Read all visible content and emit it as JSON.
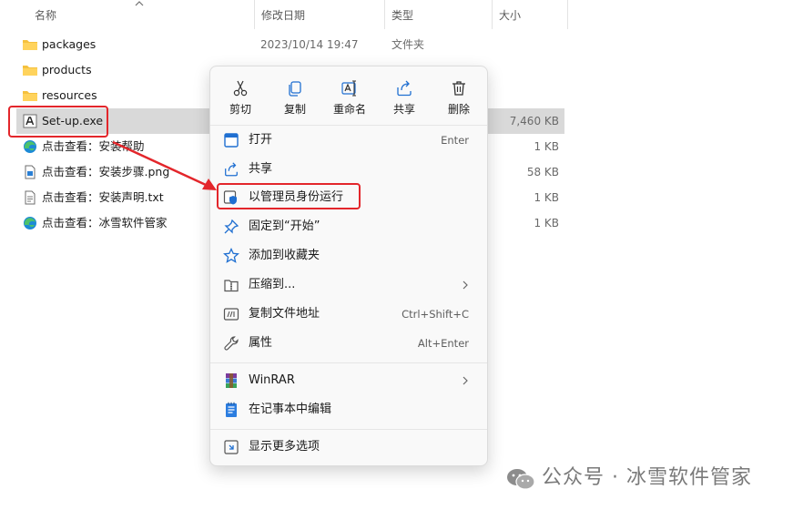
{
  "columns": {
    "name": "名称",
    "date": "修改日期",
    "type": "类型",
    "size": "大小"
  },
  "files": [
    {
      "name": "packages",
      "date": "2023/10/14 19:47",
      "type": "文件夹",
      "size": "",
      "icon": "folder-icon"
    },
    {
      "name": "products",
      "date": "",
      "type": "",
      "size": "",
      "icon": "folder-icon"
    },
    {
      "name": "resources",
      "date": "",
      "type": "",
      "size": "",
      "icon": "folder-icon"
    },
    {
      "name": "Set-up.exe",
      "date": "",
      "type": "",
      "size": "7,460 KB",
      "icon": "setup-exe-icon"
    },
    {
      "name": "点击查看：安装帮助",
      "date": "",
      "type": "",
      "size": "1 KB",
      "icon": "edge-link-icon"
    },
    {
      "name": "点击查看：安装步骤.png",
      "date": "",
      "type": "",
      "size": "58 KB",
      "icon": "png-file-icon"
    },
    {
      "name": "点击查看：安装声明.txt",
      "date": "",
      "type": "",
      "size": "1 KB",
      "icon": "txt-file-icon"
    },
    {
      "name": "点击查看：冰雪软件管家",
      "date": "",
      "type": "",
      "size": "1 KB",
      "icon": "edge-link-icon"
    }
  ],
  "context_menu": {
    "quick_actions": [
      {
        "label": "剪切",
        "icon": "scissors-icon"
      },
      {
        "label": "复制",
        "icon": "copy-icon"
      },
      {
        "label": "重命名",
        "icon": "rename-icon"
      },
      {
        "label": "共享",
        "icon": "share-icon"
      },
      {
        "label": "删除",
        "icon": "trash-icon"
      }
    ],
    "items": [
      {
        "label": "打开",
        "shortcut": "Enter",
        "icon": "open-app-icon"
      },
      {
        "label": "共享",
        "shortcut": "",
        "icon": "share-icon"
      },
      {
        "label": "以管理员身份运行",
        "shortcut": "",
        "icon": "shield-admin-icon"
      },
      {
        "label": "固定到“开始”",
        "shortcut": "",
        "icon": "pin-icon"
      },
      {
        "label": "添加到收藏夹",
        "shortcut": "",
        "icon": "star-icon"
      },
      {
        "label": "压缩到...",
        "shortcut": "",
        "icon": "zip-icon",
        "submenu": true
      },
      {
        "label": "复制文件地址",
        "shortcut": "Ctrl+Shift+C",
        "icon": "copy-path-icon"
      },
      {
        "label": "属性",
        "shortcut": "Alt+Enter",
        "icon": "wrench-icon"
      },
      {
        "label": "WinRAR",
        "shortcut": "",
        "icon": "winrar-icon",
        "submenu": true
      },
      {
        "label": "在记事本中编辑",
        "shortcut": "",
        "icon": "notepad-icon"
      },
      {
        "label": "显示更多选项",
        "shortcut": "",
        "icon": "more-options-icon"
      }
    ]
  },
  "watermark": {
    "text": "公众号 · 冰雪软件管家"
  },
  "colors": {
    "highlight_red": "#e3262b",
    "selection_bg": "#d9d9d9",
    "accent_blue": "#1f6fd1",
    "folder_yellow": "#f5c13e"
  }
}
